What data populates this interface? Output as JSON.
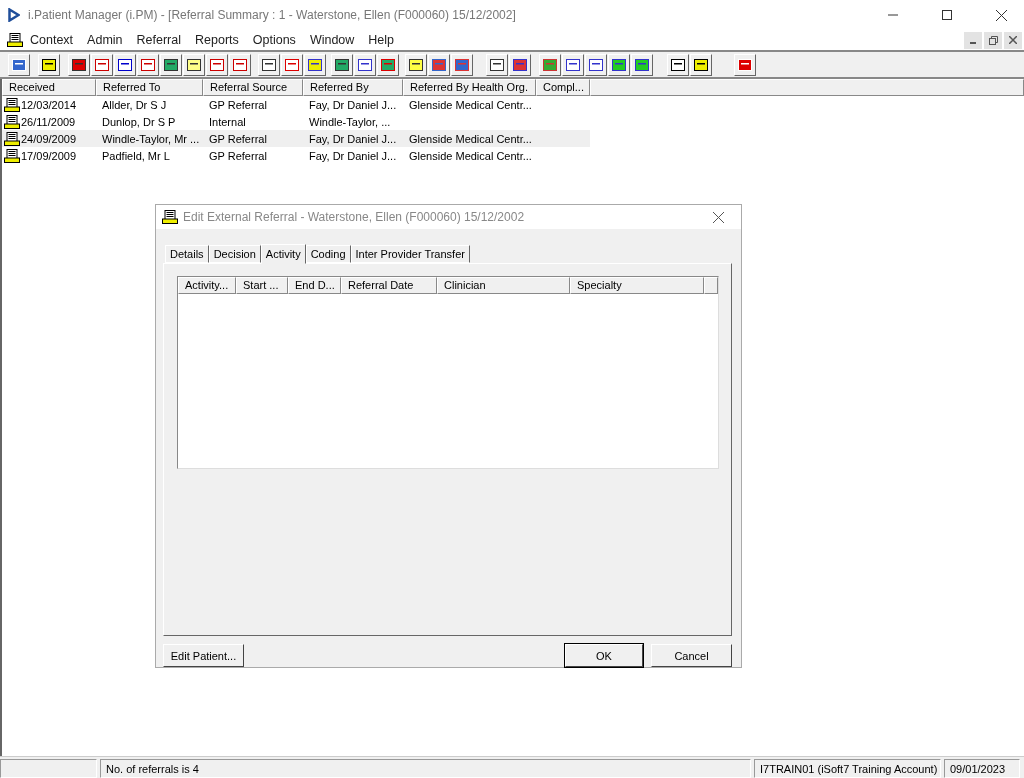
{
  "window": {
    "title": "i.Patient Manager (i.PM) - [Referral Summary : 1 - Waterstone, Ellen (F000060) 15/12/2002]"
  },
  "menu": [
    "Context",
    "Admin",
    "Referral",
    "Reports",
    "Options",
    "Window",
    "Help"
  ],
  "referrals": {
    "columns": [
      "Received",
      "Referred To",
      "Referral Source",
      "Referred By",
      "Referred By Health Org.",
      "Compl..."
    ],
    "rows": [
      {
        "selected": false,
        "cells": [
          "12/03/2014",
          "Allder, Dr S J",
          "GP Referral",
          "Fay, Dr Daniel J...",
          "Glenside Medical Centr...",
          ""
        ]
      },
      {
        "selected": false,
        "cells": [
          "26/11/2009",
          "Dunlop, Dr S P",
          "Internal",
          "Windle-Taylor, ...",
          "",
          ""
        ]
      },
      {
        "selected": true,
        "cells": [
          "24/09/2009",
          "Windle-Taylor, Mr ...",
          "GP Referral",
          "Fay, Dr Daniel J...",
          "Glenside Medical Centr...",
          ""
        ]
      },
      {
        "selected": false,
        "cells": [
          "17/09/2009",
          "Padfield, Mr L",
          "GP Referral",
          "Fay, Dr Daniel J...",
          "Glenside Medical Centr...",
          ""
        ]
      }
    ]
  },
  "dialog": {
    "title": "Edit External Referral - Waterstone, Ellen (F000060) 15/12/2002",
    "tabs": [
      {
        "label": "Details",
        "selected": false
      },
      {
        "label": "Decision",
        "selected": false
      },
      {
        "label": "Activity",
        "selected": true
      },
      {
        "label": "Coding",
        "selected": false
      },
      {
        "label": "Inter Provider Transfer",
        "selected": false
      }
    ],
    "activity_columns": [
      "Activity...",
      "Start ...",
      "End D...",
      "Referral Date",
      "Clinician",
      "Specialty"
    ],
    "buttons": {
      "left": "Edit Patient...",
      "ok": "OK",
      "cancel": "Cancel"
    }
  },
  "status_bar": {
    "message": "No. of referrals is 4",
    "account": "I7TRAIN01 (iSoft7 Training Account)",
    "date": "09/01/2023"
  }
}
